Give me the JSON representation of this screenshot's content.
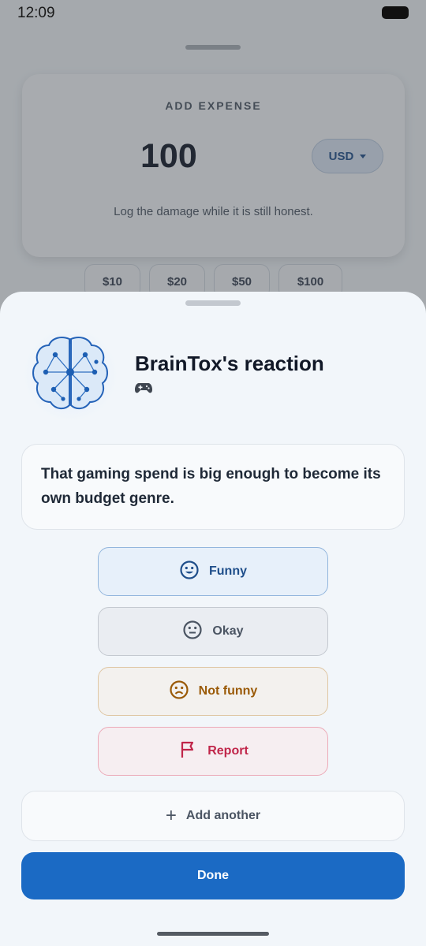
{
  "status_bar": {
    "time": "12:09"
  },
  "background": {
    "card_title": "ADD EXPENSE",
    "amount": "100",
    "currency": "USD",
    "subtitle": "Log the damage while it is still honest.",
    "quick_amounts": [
      "$10",
      "$20",
      "$50",
      "$100"
    ]
  },
  "sheet": {
    "title": "BrainTox's reaction",
    "category_icon": "gamepad-icon",
    "message": "That gaming spend is big enough to become its own budget genre.",
    "reactions": [
      {
        "label": "Funny",
        "icon": "smile-icon"
      },
      {
        "label": "Okay",
        "icon": "neutral-face-icon"
      },
      {
        "label": "Not funny",
        "icon": "frown-icon"
      },
      {
        "label": "Report",
        "icon": "flag-icon"
      }
    ],
    "add_label": "Add another",
    "done_label": "Done"
  },
  "colors": {
    "primary": "#1b6ac4",
    "funny": "#1f4e8a",
    "not_funny": "#9a5a07",
    "report": "#c0264a"
  }
}
